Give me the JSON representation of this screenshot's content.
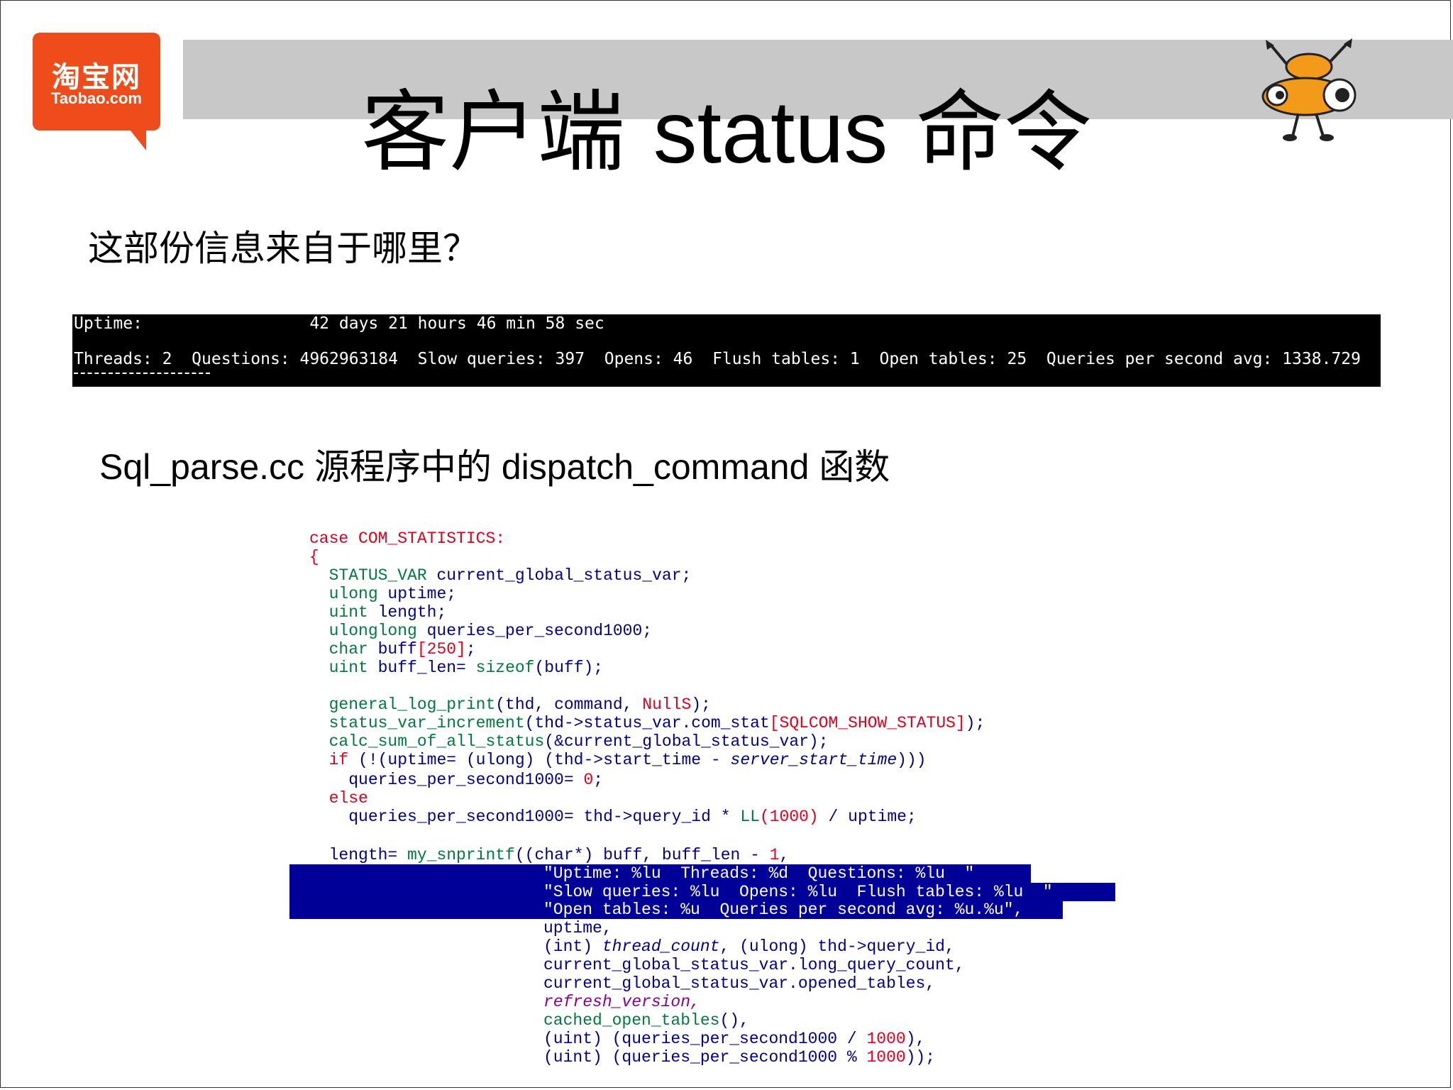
{
  "header": {
    "logo_cn": "淘宝网",
    "logo_en": "Taobao.com",
    "title_pre": "客户端 ",
    "title_latin": "status",
    "title_post": " 命令"
  },
  "question": "这部份信息来自于哪里？",
  "terminal": {
    "line1": "Uptime:                 42 days 21 hours 46 min 58 sec",
    "line2": "Threads: 2  Questions: 4962963184  Slow queries: 397  Opens: 46  Flush tables: 1  Open tables: 25  Queries per second avg: 1338.729"
  },
  "subtitle": {
    "part1": "Sql_parse.cc ",
    "part2": "源程序中的",
    "part3": " dispatch_command ",
    "part4": "函数"
  },
  "code": {
    "l01_a": "case",
    "l01_b": " COM_STATISTICS:",
    "l02": "{",
    "l03_a": "  STATUS_VAR",
    "l03_b": " current_global_status_var;",
    "l04_a": "  ulong",
    "l04_b": " uptime;",
    "l05_a": "  uint",
    "l05_b": " length;",
    "l06_a": "  ulonglong",
    "l06_b": " queries_per_second1000;",
    "l07_a": "  char",
    "l07_b": " buff",
    "l07_c": "[250]",
    "l07_d": ";",
    "l08_a": "  uint",
    "l08_b": " buff_len= ",
    "l08_c": "sizeof",
    "l08_d": "(buff);",
    "l09_a": "  general_log_print",
    "l09_b": "(thd, command, ",
    "l09_c": "NullS",
    "l09_d": ");",
    "l10_a": "  status_var_increment",
    "l10_b": "(thd->status_var.com_stat",
    "l10_c": "[SQLCOM_SHOW_STATUS]",
    "l10_d": ");",
    "l11_a": "  calc_sum_of_all_status",
    "l11_b": "(&current_global_status_var);",
    "l12_a": "  if",
    "l12_b": " (!(uptime= (ulong) (thd->start_time - ",
    "l12_c": "server_start_time",
    "l12_d": ")))",
    "l13_a": "    queries_per_second1000= ",
    "l13_b": "0",
    "l13_c": ";",
    "l14": "  else",
    "l15_a": "    queries_per_second1000= thd->query_id * ",
    "l15_b": "LL",
    "l15_c": "(1000)",
    "l15_d": " / uptime;",
    "l16_a": "  length= ",
    "l16_b": "my_snprintf",
    "l16_c": "((char*) buff, buff_len - ",
    "l16_d": "1",
    "l16_e": ",",
    "l17": "\"Uptime: %lu  Threads: %d  Questions: %lu  \"",
    "l18": "\"Slow queries: %lu  Opens: %lu  Flush tables: %lu  \"",
    "l19": "\"Open tables: %u  Queries per second avg: %u.%u\",",
    "l20": "uptime,",
    "l21_a": "(int) ",
    "l21_b": "thread_count",
    "l21_c": ", (ulong) thd->query_id,",
    "l22": "current_global_status_var.long_query_count,",
    "l23": "current_global_status_var.opened_tables,",
    "l24": "refresh_version,",
    "l25_a": "cached_open_tables",
    "l25_b": "(),",
    "l26_a": "(uint) (queries_per_second1000 / ",
    "l26_b": "1000",
    "l26_c": "),",
    "l27_a": "(uint) (queries_per_second1000 % ",
    "l27_b": "1000",
    "l27_c": "));"
  }
}
